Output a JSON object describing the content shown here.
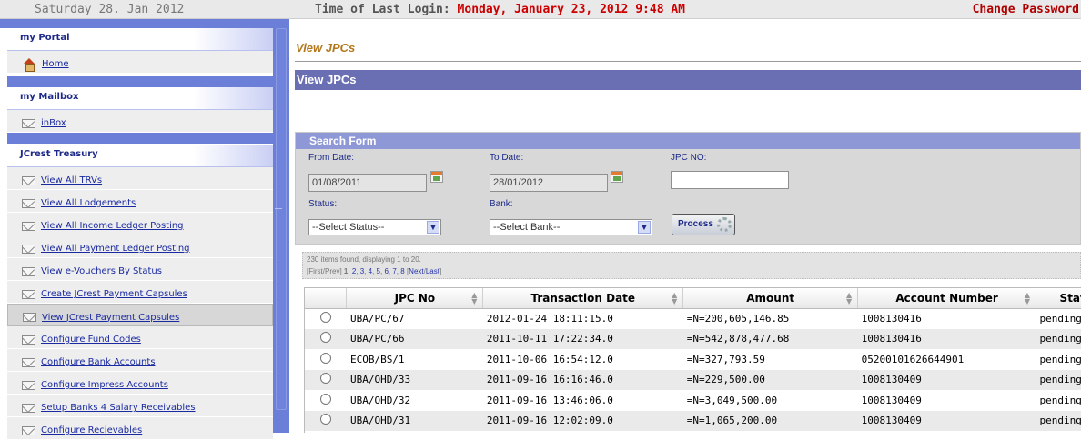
{
  "topbar": {
    "date": "Saturday 28. Jan 2012",
    "login_label": "Time of Last Login:",
    "login_time": "Monday, January 23, 2012 9:48 AM",
    "change_password": "Change Password"
  },
  "sidebar": {
    "portal": {
      "title": "my Portal",
      "items": [
        {
          "label": "Home",
          "icon": "home-icon"
        }
      ]
    },
    "mailbox": {
      "title": "my Mailbox",
      "items": [
        {
          "label": "inBox",
          "icon": "envelope-icon"
        }
      ]
    },
    "treasury": {
      "title": "JCrest Treasury",
      "items": [
        {
          "label": "View All TRVs",
          "icon": "envelope-icon"
        },
        {
          "label": "View All Lodgements",
          "icon": "envelope-icon"
        },
        {
          "label": "View All Income Ledger Posting",
          "icon": "envelope-icon"
        },
        {
          "label": "View All Payment Ledger Posting",
          "icon": "envelope-icon"
        },
        {
          "label": "View e-Vouchers By Status",
          "icon": "envelope-icon"
        },
        {
          "label": "Create JCrest Payment Capsules",
          "icon": "envelope-icon"
        },
        {
          "label": "View JCrest Payment Capsules",
          "icon": "envelope-icon",
          "active": true
        },
        {
          "label": "Configure Fund Codes",
          "icon": "envelope-icon"
        },
        {
          "label": "Configure Bank Accounts",
          "icon": "envelope-icon"
        },
        {
          "label": "Configure Impress Accounts",
          "icon": "envelope-icon"
        },
        {
          "label": "Setup Banks 4 Salary Receivables",
          "icon": "envelope-icon"
        },
        {
          "label": "Configure Recievables",
          "icon": "envelope-icon"
        }
      ]
    }
  },
  "main": {
    "page_title": "View JPCs",
    "section_title": "View JPCs",
    "search": {
      "header": "Search Form",
      "from_label": "From Date:",
      "from_value": "01/08/2011",
      "to_label": "To Date:",
      "to_value": "28/01/2012",
      "jpc_label": "JPC NO:",
      "jpc_value": "",
      "status_label": "Status:",
      "status_value": "--Select Status--",
      "bank_label": "Bank:",
      "bank_value": "--Select Bank--",
      "process_label": "Process"
    },
    "paging": {
      "summary": "230 items found, displaying 1 to 20.",
      "first_prev": "[First/Prev]",
      "current": "1",
      "pages": [
        "2",
        "3",
        "4",
        "5",
        "6",
        "7",
        "8"
      ],
      "next_last_open": "[",
      "next": "Next",
      "last": "Last",
      "next_last_close": "]"
    },
    "table": {
      "columns": [
        "JPC No",
        "Transaction Date",
        "Amount",
        "Account Number",
        "Status"
      ],
      "rows": [
        [
          "UBA/PC/67",
          "2012-01-24 18:11:15.0",
          "=N=200,605,146.85",
          "1008130416",
          "pending"
        ],
        [
          "UBA/PC/66",
          "2011-10-11 17:22:34.0",
          "=N=542,878,477.68",
          "1008130416",
          "pending"
        ],
        [
          "ECOB/BS/1",
          "2011-10-06 16:54:12.0",
          "=N=327,793.59",
          "05200101626644901",
          "pending"
        ],
        [
          "UBA/OHD/33",
          "2011-09-16 16:16:46.0",
          "=N=229,500.00",
          "1008130409",
          "pending"
        ],
        [
          "UBA/OHD/32",
          "2011-09-16 13:46:06.0",
          "=N=3,049,500.00",
          "1008130409",
          "pending"
        ],
        [
          "UBA/OHD/31",
          "2011-09-16 12:02:09.0",
          "=N=1,065,200.00",
          "1008130409",
          "pending"
        ]
      ]
    }
  },
  "chart_data": {
    "type": "table",
    "columns": [
      "JPC No",
      "Transaction Date",
      "Amount",
      "Account Number",
      "Status"
    ],
    "rows": [
      [
        "UBA/PC/67",
        "2012-01-24 18:11:15.0",
        "=N=200,605,146.85",
        "1008130416",
        "pending"
      ],
      [
        "UBA/PC/66",
        "2011-10-11 17:22:34.0",
        "=N=542,878,477.68",
        "1008130416",
        "pending"
      ],
      [
        "ECOB/BS/1",
        "2011-10-06 16:54:12.0",
        "=N=327,793.59",
        "05200101626644901",
        "pending"
      ],
      [
        "UBA/OHD/33",
        "2011-09-16 16:16:46.0",
        "=N=229,500.00",
        "1008130409",
        "pending"
      ],
      [
        "UBA/OHD/32",
        "2011-09-16 13:46:06.0",
        "=N=3,049,500.00",
        "1008130409",
        "pending"
      ],
      [
        "UBA/OHD/31",
        "2011-09-16 12:02:09.0",
        "=N=1,065,200.00",
        "1008130409",
        "pending"
      ]
    ]
  }
}
